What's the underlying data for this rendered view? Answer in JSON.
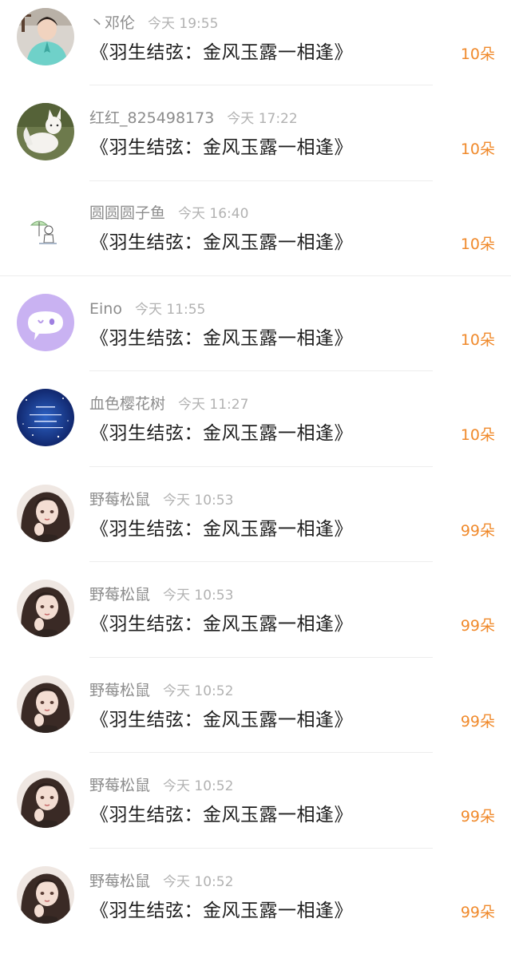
{
  "colors": {
    "name": "#8c8c8c",
    "time": "#b2b2b2",
    "gift_title": "#1f1f1f",
    "amount": "#f08a2c",
    "divider": "#ededed"
  },
  "records": [
    {
      "name": "丶邓伦",
      "time": "今天 19:55",
      "gift": "《羽生结弦：金风玉露一相逢》",
      "amount": "10朵",
      "avatar": "person-teal-shirt-avatar"
    },
    {
      "name": "红红_825498173",
      "time": "今天 17:22",
      "gift": "《羽生结弦：金风玉露一相逢》",
      "amount": "10朵",
      "avatar": "white-fox-avatar"
    },
    {
      "name": "圆圆圆子鱼",
      "time": "今天 16:40",
      "gift": "《羽生结弦：金风玉露一相逢》",
      "amount": "10朵",
      "avatar": "umbrella-doodle-avatar"
    },
    {
      "name": "Eino",
      "time": "今天 11:55",
      "gift": "《羽生结弦：金风玉露一相逢》",
      "amount": "10朵",
      "avatar": "purple-chat-bubble-avatar"
    },
    {
      "name": "血色樱花树",
      "time": "今天 11:27",
      "gift": "《羽生结弦：金风玉露一相逢》",
      "amount": "10朵",
      "avatar": "starry-night-avatar"
    },
    {
      "name": "野莓松鼠",
      "time": "今天 10:53",
      "gift": "《羽生结弦：金风玉露一相逢》",
      "amount": "99朵",
      "avatar": "anime-girl-avatar"
    },
    {
      "name": "野莓松鼠",
      "time": "今天 10:53",
      "gift": "《羽生结弦：金风玉露一相逢》",
      "amount": "99朵",
      "avatar": "anime-girl-avatar"
    },
    {
      "name": "野莓松鼠",
      "time": "今天 10:52",
      "gift": "《羽生结弦：金风玉露一相逢》",
      "amount": "99朵",
      "avatar": "anime-girl-avatar"
    },
    {
      "name": "野莓松鼠",
      "time": "今天 10:52",
      "gift": "《羽生结弦：金风玉露一相逢》",
      "amount": "99朵",
      "avatar": "anime-girl-avatar"
    },
    {
      "name": "野莓松鼠",
      "time": "今天 10:52",
      "gift": "《羽生结弦：金风玉露一相逢》",
      "amount": "99朵",
      "avatar": "anime-girl-avatar"
    }
  ]
}
